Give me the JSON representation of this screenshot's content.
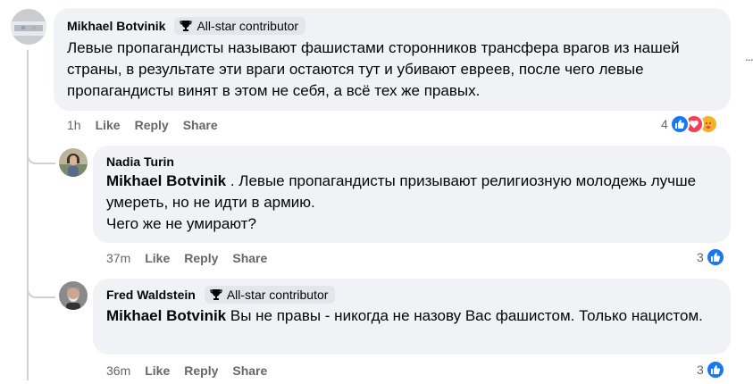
{
  "comments": [
    {
      "author": "Mikhael Botvinik",
      "badge": "All-star contributor",
      "body": "Левые пропагандисты называют фашистами сторонников трансфера врагов из нашей страны, в результате эти враги остаются тут и убивают евреев, после чего левые пропагандисты винят в этом не себя, а всё тех же правых.",
      "time": "1h",
      "like": "Like",
      "reply": "Reply",
      "share": "Share",
      "reaction_count": "4",
      "reactions": [
        "like-icon",
        "love-icon",
        "care-icon"
      ]
    },
    {
      "author": "Nadia Turin",
      "mention": "Mikhael Botvinik",
      "body": " . Левые пропагандисты призывают религиозную молодежь лучше умереть, но не идти в армию.",
      "body2": "Чего же не умирают?",
      "time": "37m",
      "like": "Like",
      "reply": "Reply",
      "share": "Share",
      "reaction_count": "3",
      "reactions": [
        "like-icon"
      ]
    },
    {
      "author": "Fred Waldstein",
      "badge": "All-star contributor",
      "mention": "Mikhael Botvinik",
      "body": " Вы не правы - никогда не назову Вас фашистом. Только нацистом.",
      "time": "36m",
      "like": "Like",
      "reply": "Reply",
      "share": "Share",
      "reaction_count": "3",
      "reactions": [
        "like-icon"
      ]
    }
  ],
  "more_menu": "..."
}
